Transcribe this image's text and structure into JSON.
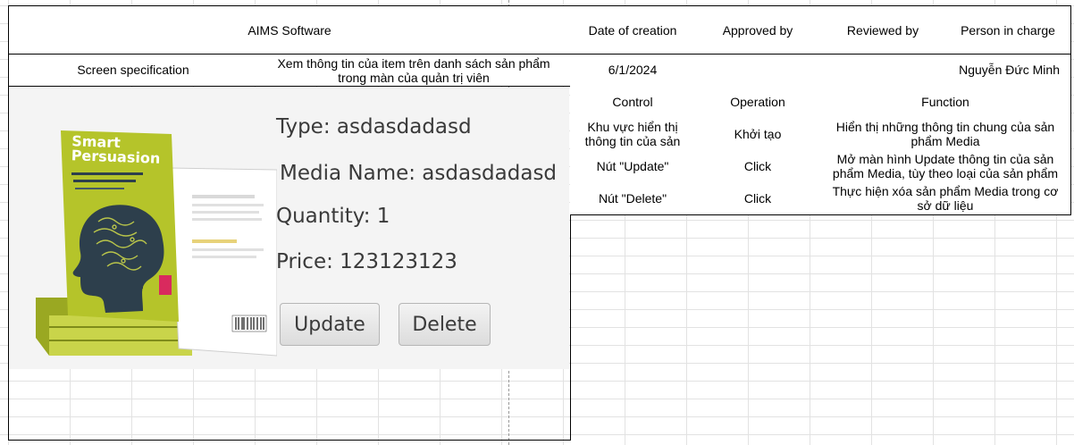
{
  "header": {
    "app_title": "AIMS Software",
    "date_of_creation_label": "Date of creation",
    "approved_by_label": "Approved by",
    "reviewed_by_label": "Reviewed by",
    "person_in_charge_label": "Person in charge"
  },
  "spec_row": {
    "label": "Screen specification",
    "description": "Xem thông tin của item trên danh sách sản phẩm trong màn của quản trị viên",
    "date": "6/1/2024",
    "approved_by": "",
    "reviewed_by": "",
    "person_in_charge": "Nguyễn Đức Minh"
  },
  "screen": {
    "book_title_line1": "Smart",
    "book_title_line2": "Persuasion",
    "type_label": "Type: asdasdadasd",
    "media_name_label": "Media Name: asdasdadasd",
    "quantity_label": "Quantity: 1",
    "price_label": "Price: 123123123",
    "update_button": "Update",
    "delete_button": "Delete"
  },
  "table": {
    "headers": {
      "control": "Control",
      "operation": "Operation",
      "function": "Function"
    },
    "rows": [
      {
        "control": "Khu vực hiển thị thông tin của sản",
        "operation": "Khởi tạo",
        "function": "Hiển thị những thông tin chung của sản phẩm Media"
      },
      {
        "control": "Nút \"Update\"",
        "operation": "Click",
        "function": "Mở màn hình Update thông tin của sản phẩm Media, tùy theo loại của sản phẩm"
      },
      {
        "control": "Nút \"Delete\"",
        "operation": "Click",
        "function": "Thực hiện xóa sản phẩm Media trong cơ sở dữ liệu"
      }
    ]
  },
  "colors": {
    "book_green": "#b5c42a",
    "book_dark": "#2d3f4c",
    "border": "#000000",
    "screen_bg": "#f4f4f4"
  }
}
